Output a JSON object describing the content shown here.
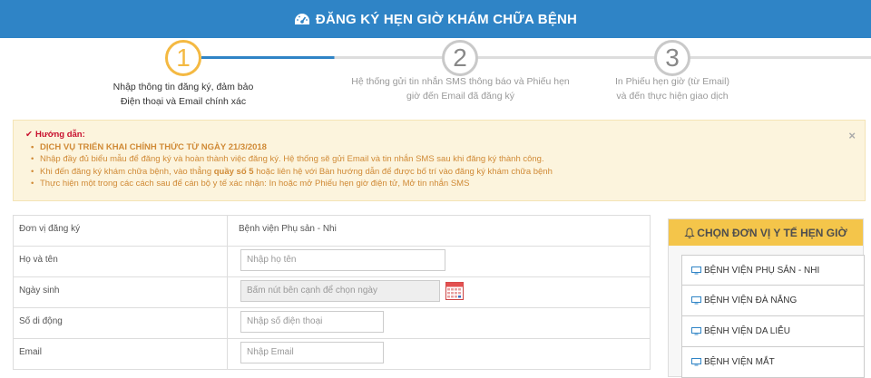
{
  "header": {
    "title": "ĐĂNG KÝ HẸN GIỜ KHÁM CHỮA BỆNH"
  },
  "steps": [
    {
      "number": "1",
      "text_line1": "Nhập thông tin đăng ký, đảm bảo",
      "text_line2": "Điện thoại và Email chính xác"
    },
    {
      "number": "2",
      "text_line1": "Hệ thống gửi tin nhắn SMS thông báo và Phiếu hẹn",
      "text_line2": "giờ đến Email đã đăng ký"
    },
    {
      "number": "3",
      "text_line1": "In Phiếu hẹn giờ (từ Email)",
      "text_line2": "và đến thực hiện giao dịch"
    }
  ],
  "guide": {
    "title": "Hướng dẫn:",
    "items": [
      "DỊCH VỤ TRIỂN KHAI CHÍNH THỨC TỪ NGÀY 21/3/2018",
      "Nhập đầy đủ biểu mẫu để đăng ký và hoàn thành việc đăng ký. Hệ thống sẽ gửi Email và tin nhắn SMS sau khi đăng ký thành công.",
      "Khi đến đăng ký khám chữa bệnh, vào thẳng",
      "Thực hiện một trong các cách sau để cán bộ y tế xác nhận: In hoặc mở Phiếu hẹn giờ điện tử, Mở tin nhắn SMS"
    ],
    "item3_bold": "quầy số 5",
    "item3_rest": "hoặc liên hệ với Bàn hướng dẫn để được bố trí vào đăng ký khám chữa bệnh",
    "close": "×"
  },
  "form": {
    "unit_label": "Đơn vị đăng ký",
    "unit_value": "Bệnh viện Phụ sản - Nhi",
    "name_label": "Họ và tên",
    "name_placeholder": "Nhập họ tên",
    "dob_label": "Ngày sinh",
    "dob_placeholder": "Bấm nút bên cạnh để chọn ngày",
    "phone_label": "Số di động",
    "phone_placeholder": "Nhập số điện thoại",
    "email_label": "Email",
    "email_placeholder": "Nhập Email"
  },
  "side": {
    "title": "CHỌN ĐƠN VỊ Y TẾ HẸN GIỜ",
    "items": [
      "BỆNH VIỆN PHỤ SẢN - NHI",
      "BỆNH VIỆN ĐÀ NẴNG",
      "BỆNH VIỆN DA LIỄU",
      "BỆNH VIỆN MẮT"
    ]
  },
  "colors": {
    "header": "#2f84c6",
    "active_step": "#f4b942",
    "guide_bg": "#fcf4dd",
    "side_head": "#f4c54a"
  }
}
